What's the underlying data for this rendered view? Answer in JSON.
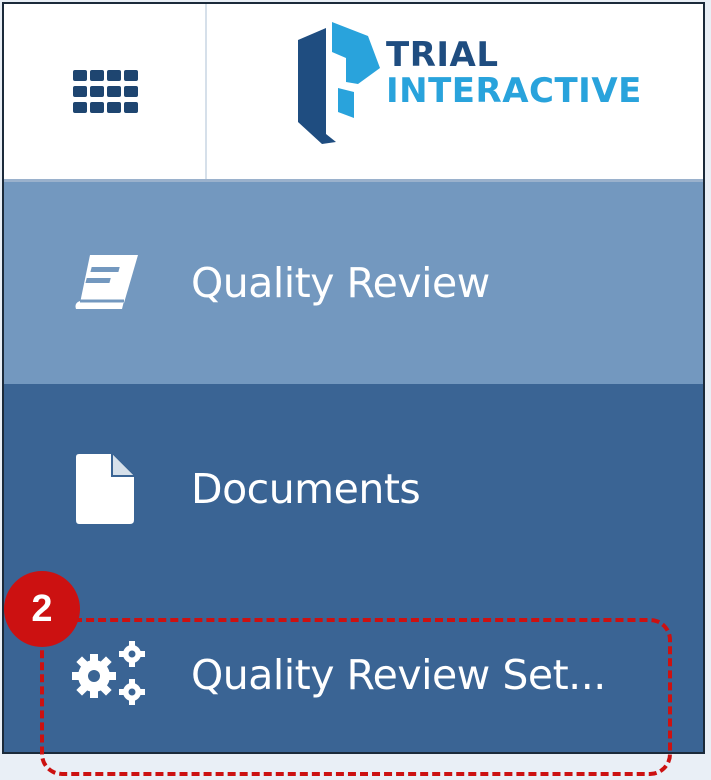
{
  "header": {
    "apps_icon": "grid-icon",
    "logo": {
      "line1": "TRIAL",
      "line2": "INTERACTIVE",
      "colors": {
        "dark": "#1f4d80",
        "light": "#29a3dc"
      }
    }
  },
  "nav": {
    "items": [
      {
        "label": "Quality Review",
        "icon": "book-icon",
        "state": "active"
      },
      {
        "label": "Documents",
        "icon": "document-icon",
        "state": "default"
      },
      {
        "label": "Quality Review Set...",
        "icon": "gears-icon",
        "state": "default"
      }
    ]
  },
  "annotation": {
    "step": "2",
    "color": "#cc1111"
  },
  "colors": {
    "active_bg": "#7398bf",
    "nav_bg": "#3a6494",
    "header_bg": "#ffffff"
  }
}
